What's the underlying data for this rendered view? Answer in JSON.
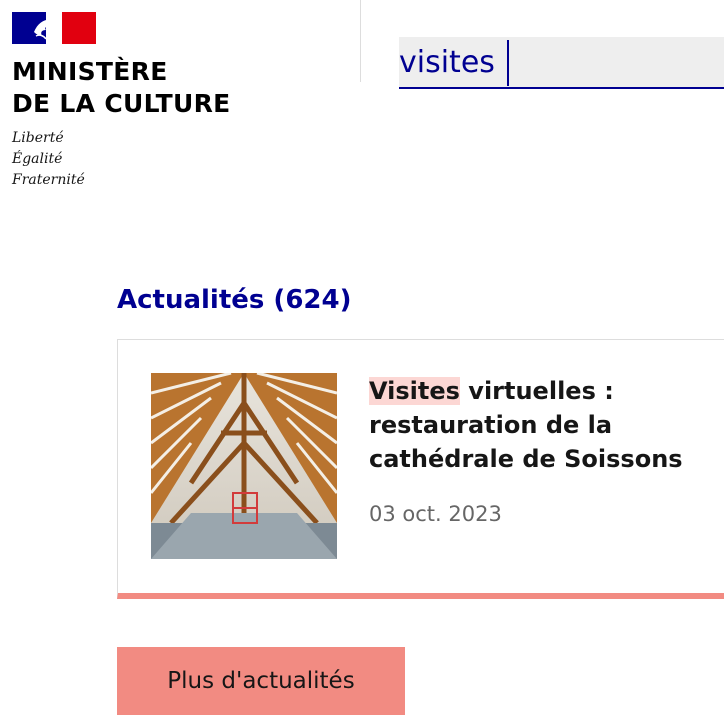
{
  "header": {
    "ministry_line1": "MINISTÈRE",
    "ministry_line2": "DE LA CULTURE",
    "motto": [
      "Liberté",
      "Égalité",
      "Fraternité"
    ]
  },
  "search": {
    "value": "visites"
  },
  "results": {
    "section_title": "Actualités (624)",
    "cards": [
      {
        "title_highlight": "Visites",
        "title_rest": " virtuelles : restauration de la cathédrale de Soissons",
        "date": "03 oct. 2023",
        "image": "cathedral-roof-timber-frame-photo"
      }
    ],
    "more_button": "Plus d'actualités"
  },
  "colors": {
    "brand_blue": "#000091",
    "marianne_red": "#e1000f",
    "accent_pink": "#f28b82",
    "highlight": "#fcd7d4"
  }
}
